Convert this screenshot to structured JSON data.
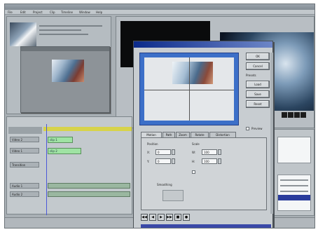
{
  "app": {
    "title": "",
    "menu": [
      "File",
      "Edit",
      "Project",
      "Clip",
      "Timeline",
      "Window",
      "Help"
    ]
  },
  "timeline": {
    "tracks": [
      "Video 2",
      "Video 1",
      "Transition",
      "Audio 1",
      "Audio 2"
    ],
    "clips": [
      "clip 1",
      "clip 2"
    ]
  },
  "dialog": {
    "title": "",
    "buttons": [
      "OK",
      "Cancel",
      "Load",
      "Save",
      "Reset"
    ],
    "side_labels": [
      "Presets",
      "Preview"
    ],
    "tabs": [
      "Motion",
      "Path",
      "Zoom",
      "Rotate",
      "Distortion"
    ],
    "position_group": "Position",
    "scale_group": "Scale",
    "fields": {
      "x_label": "X:",
      "x_value": "0",
      "y_label": "Y:",
      "y_value": "0",
      "w_label": "W:",
      "w_value": "100",
      "h_label": "H:",
      "h_value": "100"
    },
    "checkbox_label": "Preview",
    "anchor_label": "Smoothing",
    "transport": [
      "◀◀",
      "◀",
      "▶",
      "▶▶",
      "■",
      "●"
    ]
  },
  "status": {
    "text": ""
  },
  "colors": {
    "dialog_title": "#0b2a8a",
    "preview_border": "#3c6fc8",
    "clip_green": "#9fe3a3",
    "ruler_yellow": "#d7d34a",
    "selection_blue": "#2a3c9c"
  }
}
